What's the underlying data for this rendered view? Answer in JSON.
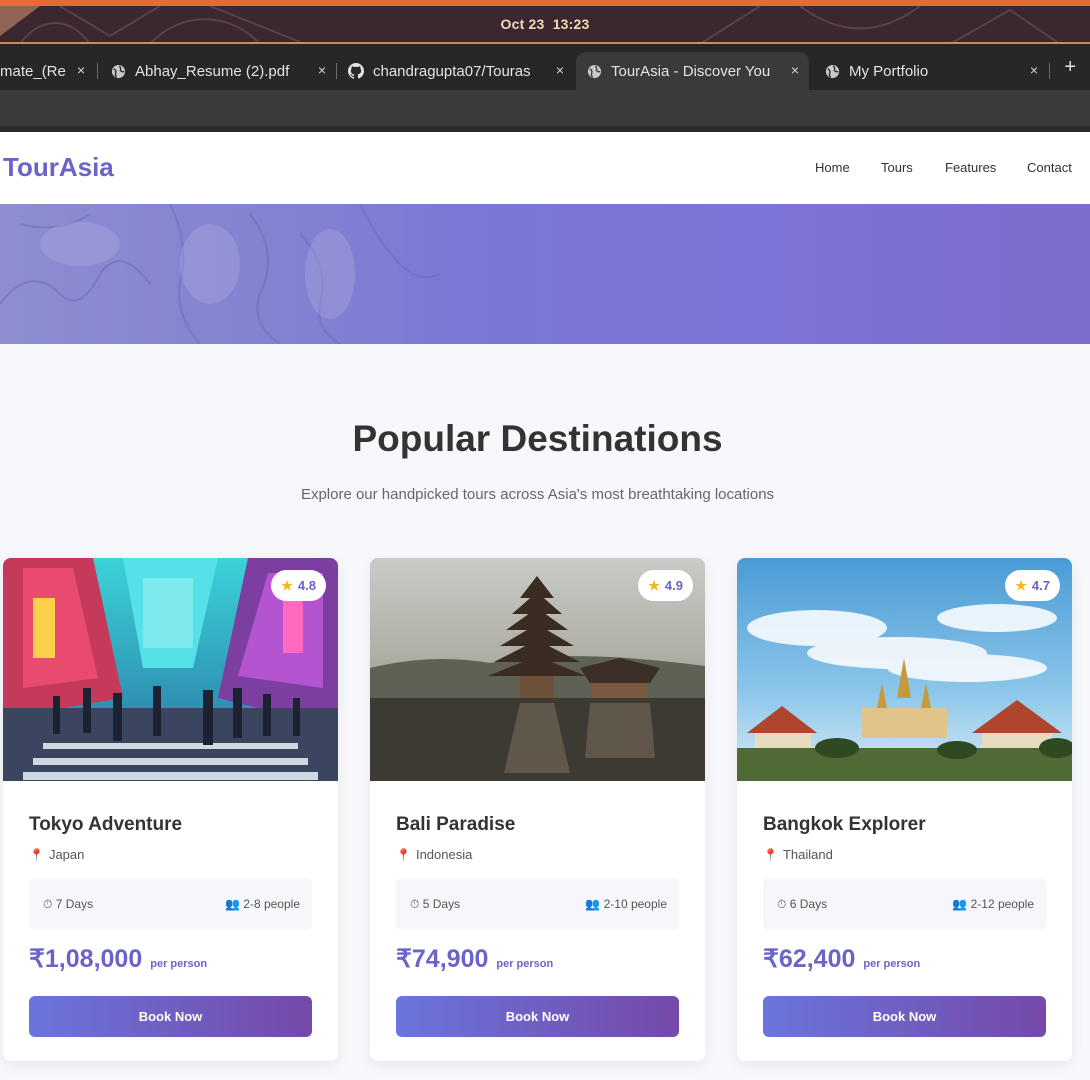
{
  "os": {
    "clock_date": "Oct 23",
    "clock_time": "13:23"
  },
  "browser": {
    "tabs": [
      {
        "title": "mate_(Re",
        "icon": "tab-fragment"
      },
      {
        "title": "Abhay_Resume (2).pdf",
        "icon": "globe-icon"
      },
      {
        "title": "chandragupta07/Touras",
        "icon": "github-icon"
      },
      {
        "title": "TourAsia - Discover You",
        "icon": "globe-icon",
        "active": true
      },
      {
        "title": "My Portfolio",
        "icon": "globe-icon"
      }
    ],
    "close_glyph": "×",
    "new_tab_glyph": "+"
  },
  "site": {
    "brand": "TourAsia",
    "nav": [
      "Home",
      "Tours",
      "Features",
      "Contact"
    ]
  },
  "section": {
    "title": "Popular Destinations",
    "subtitle": "Explore our handpicked tours across Asia's most breathtaking locations"
  },
  "tours": [
    {
      "name": "Tokyo Adventure",
      "location": "Japan",
      "rating": "4.8",
      "duration": "7 Days",
      "group": "2-8 people",
      "price": "₹1,08,000",
      "per": "per person",
      "cta": "Book Now"
    },
    {
      "name": "Bali Paradise",
      "location": "Indonesia",
      "rating": "4.9",
      "duration": "5 Days",
      "group": "2-10 people",
      "price": "₹74,900",
      "per": "per person",
      "cta": "Book Now"
    },
    {
      "name": "Bangkok Explorer",
      "location": "Thailand",
      "rating": "4.7",
      "duration": "6 Days",
      "group": "2-12 people",
      "price": "₹62,400",
      "per": "per person",
      "cta": "Book Now"
    }
  ],
  "colors": {
    "brand": "#6a64c9",
    "button_start": "#6a75dc",
    "button_end": "#7549a8",
    "hero": "#7a78d4",
    "star": "#f2b61e"
  }
}
